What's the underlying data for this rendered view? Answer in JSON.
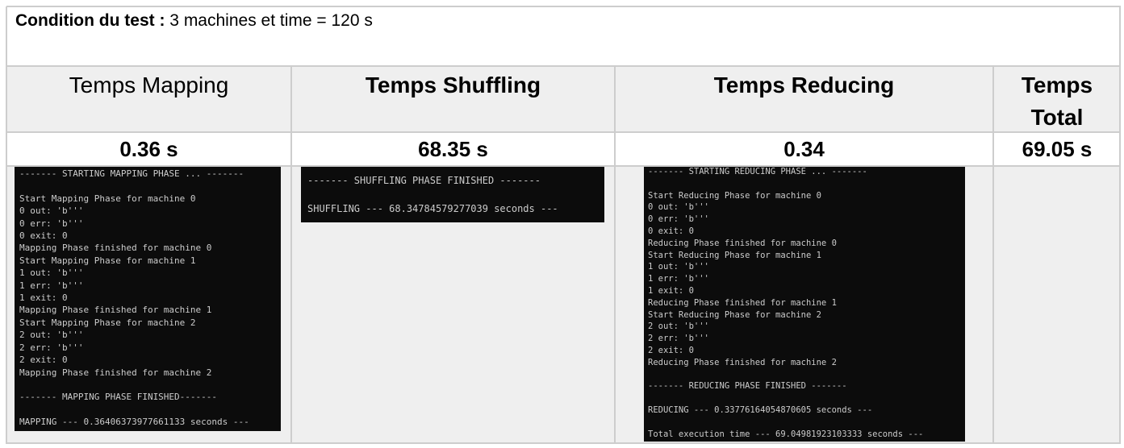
{
  "condition": {
    "label": "Condition du test :",
    "text": " 3 machines et time = 120 s"
  },
  "headers": {
    "mapping": "Temps Mapping",
    "shuffling": "Temps Shuffling",
    "reducing": "Temps Reducing",
    "total_line1": "Temps",
    "total_line2": "Total"
  },
  "values": {
    "mapping": "0.36 s",
    "shuffling": "68.35 s",
    "reducing": "0.34",
    "total": "69.05 s"
  },
  "terminals": {
    "mapping": [
      "------- STARTING MAPPING PHASE ... -------",
      "",
      "Start Mapping Phase for machine 0",
      "0 out: 'b'''",
      "0 err: 'b'''",
      "0 exit: 0",
      "Mapping Phase finished for machine 0",
      "Start Mapping Phase for machine 1",
      "1 out: 'b'''",
      "1 err: 'b'''",
      "1 exit: 0",
      "Mapping Phase finished for machine 1",
      "Start Mapping Phase for machine 2",
      "2 out: 'b'''",
      "2 err: 'b'''",
      "2 exit: 0",
      "Mapping Phase finished for machine 2",
      "",
      "------- MAPPING PHASE FINISHED-------",
      "",
      "MAPPING --- 0.36406373977661133 seconds ---"
    ],
    "shuffling": [
      "------- SHUFFLING PHASE FINISHED -------",
      "",
      "SHUFFLING --- 68.34784579277039 seconds ---"
    ],
    "reducing": [
      "------- STARTING REDUCING PHASE ... -------",
      "",
      "Start Reducing Phase for machine 0",
      "0 out: 'b'''",
      "0 err: 'b'''",
      "0 exit: 0",
      "Reducing Phase finished for machine 0",
      "Start Reducing Phase for machine 1",
      "1 out: 'b'''",
      "1 err: 'b'''",
      "1 exit: 0",
      "Reducing Phase finished for machine 1",
      "Start Reducing Phase for machine 2",
      "2 out: 'b'''",
      "2 err: 'b'''",
      "2 exit: 0",
      "Reducing Phase finished for machine 2",
      "",
      "------- REDUCING PHASE FINISHED -------",
      "",
      "REDUCING --- 0.33776164054870605 seconds ---",
      "",
      "Total execution time --- 69.04981923103333 seconds ---"
    ]
  },
  "colors": {
    "header_bg": "#efefef",
    "grid": "#cdcdcd",
    "terminal_bg": "#0c0c0c",
    "terminal_fg": "#cccccc"
  }
}
